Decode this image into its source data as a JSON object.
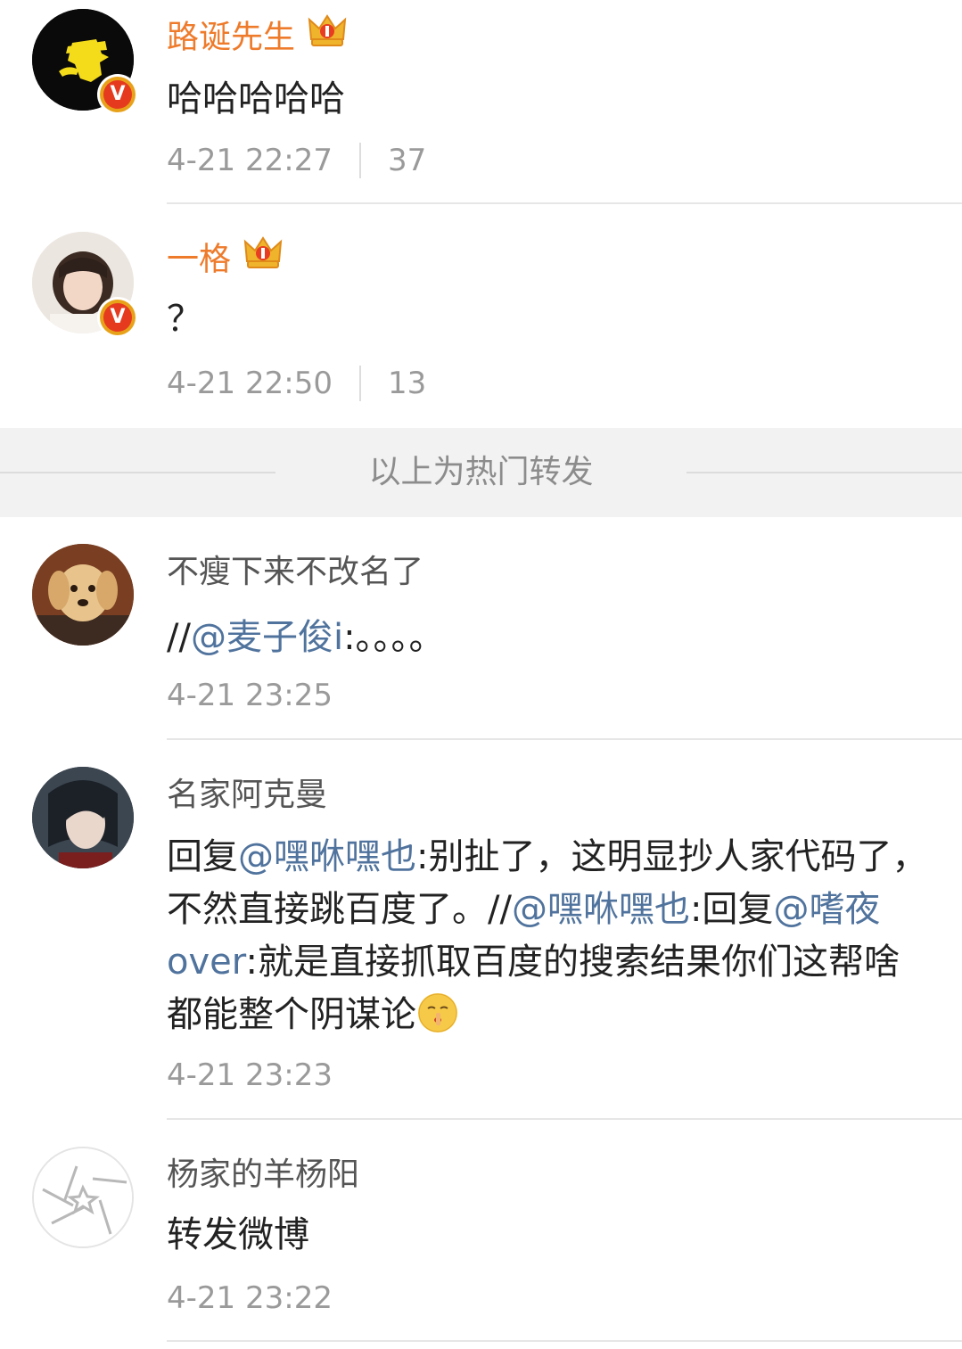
{
  "reposts": [
    {
      "username": "路诞先生",
      "text": "哈哈哈哈哈",
      "time": "4-21 22:27",
      "likes": "37",
      "verified": true,
      "vip": true
    },
    {
      "username": "一格",
      "text": "？",
      "time": "4-21 22:50",
      "likes": "13",
      "verified": true,
      "vip": true
    }
  ],
  "hot_divider_label": "以上为热门转发",
  "comments": [
    {
      "username": "不瘦下来不改名了",
      "text_prefix": "//",
      "mention": "@麦子俊i",
      "text_suffix": ":。。。。",
      "time": "4-21 23:25"
    },
    {
      "username": "名家阿克曼",
      "line1_a": "回复",
      "line1_mention": "@嘿咻嘿也",
      "line1_b": ":别扯了，这明显抄人家代码了，不然直接跳百度了。//",
      "line2_mention": "@嘿咻嘿也",
      "line2_a": ":回复",
      "line3_mention": "@嗜夜over",
      "line3_b": ":就是直接抓取百度的搜索结果你们这帮啥都能整个阴谋论",
      "emoji": "shush-emoji",
      "time": "4-21 23:23"
    },
    {
      "username": "杨家的羊杨阳",
      "text": "转发微博",
      "time": "4-21 23:22"
    }
  ],
  "colors": {
    "vip_name": "#ee7b2b",
    "mention": "#50739d",
    "meta": "#9a9a9a",
    "verified_badge": "#e63a1f",
    "crown": "#e8a21a"
  }
}
